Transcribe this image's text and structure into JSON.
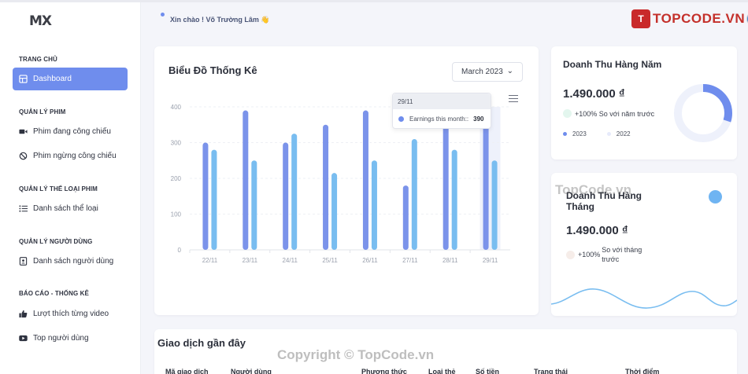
{
  "logo": "MX",
  "greeting": "Xin chào ! Võ Trường Lâm 👋",
  "brand": {
    "badge": "T",
    "text": "TOPCODE.VN"
  },
  "sidebar": {
    "sections": [
      {
        "title": "TRANG CHỦ",
        "items": [
          {
            "label": "Dashboard",
            "icon": "dashboard-icon",
            "active": true
          }
        ]
      },
      {
        "title": "QUẢN LÝ PHIM",
        "items": [
          {
            "label": "Phim đang công chiếu",
            "icon": "video-icon"
          },
          {
            "label": "Phim ngừng công chiếu",
            "icon": "ban-icon"
          }
        ]
      },
      {
        "title": "QUẢN LÝ THỂ LOẠI PHIM",
        "items": [
          {
            "label": "Danh sách thể loại",
            "icon": "list-icon"
          }
        ]
      },
      {
        "title": "QUẢN LÝ NGƯỜI DÙNG",
        "items": [
          {
            "label": "Danh sách người dùng",
            "icon": "user-card-icon"
          }
        ]
      },
      {
        "title": "BÁO CÁO - THỐNG KÊ",
        "items": [
          {
            "label": "Lượt thích từng video",
            "icon": "thumbs-up-icon"
          },
          {
            "label": "Top người dùng",
            "icon": "youtube-icon"
          }
        ]
      }
    ]
  },
  "chart_card": {
    "title": "Biểu Đồ Thống Kê",
    "month": "March 2023"
  },
  "chart_data": {
    "type": "bar",
    "categories": [
      "22/11",
      "23/11",
      "24/11",
      "25/11",
      "26/11",
      "27/11",
      "28/11",
      "29/11"
    ],
    "series": [
      {
        "values": [
          300,
          390,
          300,
          350,
          390,
          180,
          390,
          390
        ],
        "color": "#7b93ea"
      },
      {
        "values": [
          280,
          250,
          325,
          215,
          250,
          310,
          280,
          250
        ],
        "color": "#79bdf0"
      }
    ],
    "ylim": [
      0,
      400
    ],
    "yticks": [
      0,
      100,
      200,
      300,
      400
    ],
    "tooltip": {
      "date": "29/11",
      "label": "Earnings this month::",
      "value": "390"
    }
  },
  "year_card": {
    "title": "Doanh Thu Hàng Năm",
    "value": "1.490.000 ₫",
    "change_pct": "+100%",
    "change_label": "So với năm trước",
    "legend": [
      "2023",
      "2022"
    ],
    "donut_fraction": 0.3,
    "colors": {
      "primary": "#6f8ded",
      "light": "#eef1fb"
    }
  },
  "month_card": {
    "title": "Doanh Thu Hàng Tháng",
    "value": "1.490.000 ₫",
    "change_pct": "+100%",
    "change_label": "So với tháng trước"
  },
  "transactions": {
    "title": "Giao dịch gần đây",
    "columns": [
      "Mã giao dịch",
      "Người dùng",
      "Phương thức",
      "Loại thẻ",
      "Số tiền",
      "Trạng thái",
      "Thời điểm"
    ]
  },
  "watermarks": [
    "TopCode.vn",
    "Copyright © TopCode.vn"
  ]
}
